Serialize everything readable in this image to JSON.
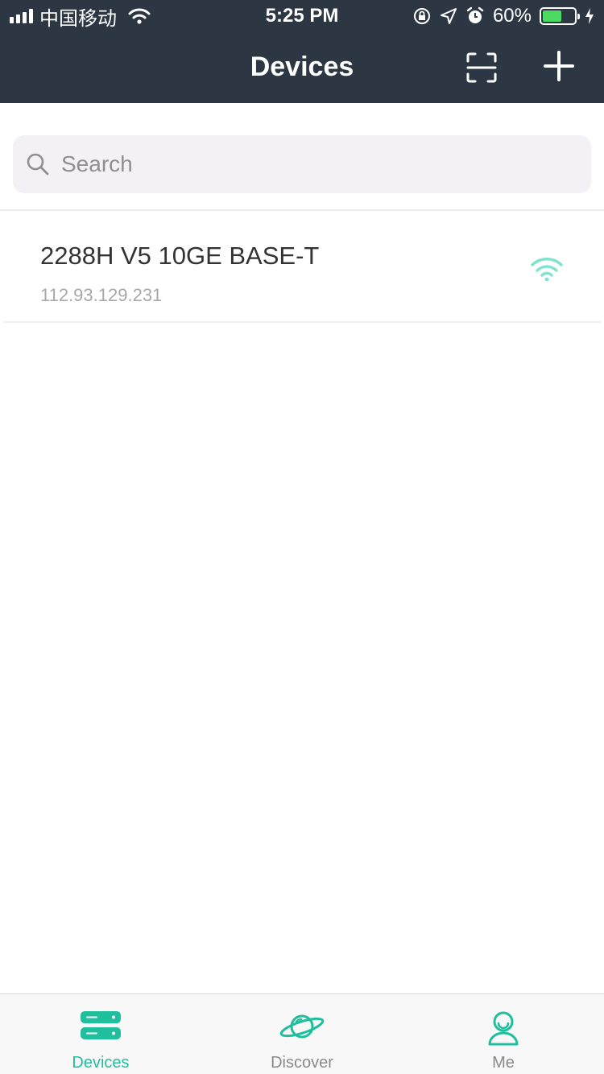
{
  "status_bar": {
    "carrier": "中国移动",
    "time": "5:25 PM",
    "battery_percent": "60%",
    "battery_level": 0.6
  },
  "nav": {
    "title": "Devices",
    "scan_icon": "scan-icon",
    "add_icon": "plus-icon"
  },
  "search": {
    "placeholder": "Search",
    "value": ""
  },
  "devices": [
    {
      "name": "2288H V5 10GE BASE-T",
      "ip": "112.93.129.231",
      "status_icon": "wifi-icon"
    }
  ],
  "tabs": [
    {
      "label": "Devices",
      "icon": "server-icon",
      "active": true
    },
    {
      "label": "Discover",
      "icon": "planet-icon",
      "active": false
    },
    {
      "label": "Me",
      "icon": "user-icon",
      "active": false
    }
  ],
  "colors": {
    "navbar": "#2d3743",
    "accent": "#1fbf9e",
    "battery": "#4cd964"
  }
}
